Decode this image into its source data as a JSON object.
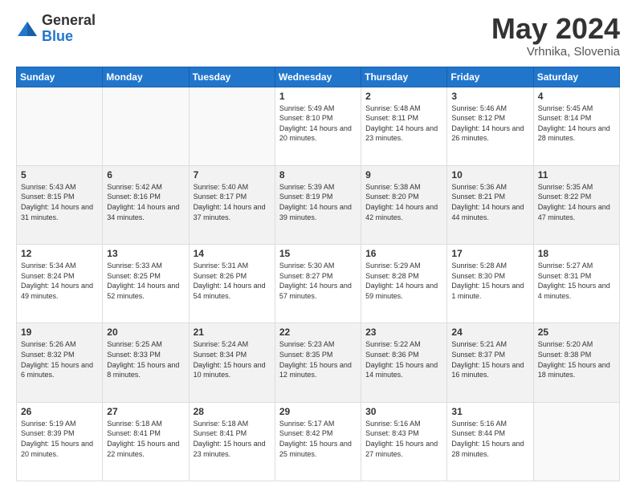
{
  "logo": {
    "general": "General",
    "blue": "Blue"
  },
  "title": "May 2024",
  "subtitle": "Vrhnika, Slovenia",
  "weekdays": [
    "Sunday",
    "Monday",
    "Tuesday",
    "Wednesday",
    "Thursday",
    "Friday",
    "Saturday"
  ],
  "weeks": [
    [
      {
        "day": "",
        "sunrise": "",
        "sunset": "",
        "daylight": ""
      },
      {
        "day": "",
        "sunrise": "",
        "sunset": "",
        "daylight": ""
      },
      {
        "day": "",
        "sunrise": "",
        "sunset": "",
        "daylight": ""
      },
      {
        "day": "1",
        "sunrise": "Sunrise: 5:49 AM",
        "sunset": "Sunset: 8:10 PM",
        "daylight": "Daylight: 14 hours and 20 minutes."
      },
      {
        "day": "2",
        "sunrise": "Sunrise: 5:48 AM",
        "sunset": "Sunset: 8:11 PM",
        "daylight": "Daylight: 14 hours and 23 minutes."
      },
      {
        "day": "3",
        "sunrise": "Sunrise: 5:46 AM",
        "sunset": "Sunset: 8:12 PM",
        "daylight": "Daylight: 14 hours and 26 minutes."
      },
      {
        "day": "4",
        "sunrise": "Sunrise: 5:45 AM",
        "sunset": "Sunset: 8:14 PM",
        "daylight": "Daylight: 14 hours and 28 minutes."
      }
    ],
    [
      {
        "day": "5",
        "sunrise": "Sunrise: 5:43 AM",
        "sunset": "Sunset: 8:15 PM",
        "daylight": "Daylight: 14 hours and 31 minutes."
      },
      {
        "day": "6",
        "sunrise": "Sunrise: 5:42 AM",
        "sunset": "Sunset: 8:16 PM",
        "daylight": "Daylight: 14 hours and 34 minutes."
      },
      {
        "day": "7",
        "sunrise": "Sunrise: 5:40 AM",
        "sunset": "Sunset: 8:17 PM",
        "daylight": "Daylight: 14 hours and 37 minutes."
      },
      {
        "day": "8",
        "sunrise": "Sunrise: 5:39 AM",
        "sunset": "Sunset: 8:19 PM",
        "daylight": "Daylight: 14 hours and 39 minutes."
      },
      {
        "day": "9",
        "sunrise": "Sunrise: 5:38 AM",
        "sunset": "Sunset: 8:20 PM",
        "daylight": "Daylight: 14 hours and 42 minutes."
      },
      {
        "day": "10",
        "sunrise": "Sunrise: 5:36 AM",
        "sunset": "Sunset: 8:21 PM",
        "daylight": "Daylight: 14 hours and 44 minutes."
      },
      {
        "day": "11",
        "sunrise": "Sunrise: 5:35 AM",
        "sunset": "Sunset: 8:22 PM",
        "daylight": "Daylight: 14 hours and 47 minutes."
      }
    ],
    [
      {
        "day": "12",
        "sunrise": "Sunrise: 5:34 AM",
        "sunset": "Sunset: 8:24 PM",
        "daylight": "Daylight: 14 hours and 49 minutes."
      },
      {
        "day": "13",
        "sunrise": "Sunrise: 5:33 AM",
        "sunset": "Sunset: 8:25 PM",
        "daylight": "Daylight: 14 hours and 52 minutes."
      },
      {
        "day": "14",
        "sunrise": "Sunrise: 5:31 AM",
        "sunset": "Sunset: 8:26 PM",
        "daylight": "Daylight: 14 hours and 54 minutes."
      },
      {
        "day": "15",
        "sunrise": "Sunrise: 5:30 AM",
        "sunset": "Sunset: 8:27 PM",
        "daylight": "Daylight: 14 hours and 57 minutes."
      },
      {
        "day": "16",
        "sunrise": "Sunrise: 5:29 AM",
        "sunset": "Sunset: 8:28 PM",
        "daylight": "Daylight: 14 hours and 59 minutes."
      },
      {
        "day": "17",
        "sunrise": "Sunrise: 5:28 AM",
        "sunset": "Sunset: 8:30 PM",
        "daylight": "Daylight: 15 hours and 1 minute."
      },
      {
        "day": "18",
        "sunrise": "Sunrise: 5:27 AM",
        "sunset": "Sunset: 8:31 PM",
        "daylight": "Daylight: 15 hours and 4 minutes."
      }
    ],
    [
      {
        "day": "19",
        "sunrise": "Sunrise: 5:26 AM",
        "sunset": "Sunset: 8:32 PM",
        "daylight": "Daylight: 15 hours and 6 minutes."
      },
      {
        "day": "20",
        "sunrise": "Sunrise: 5:25 AM",
        "sunset": "Sunset: 8:33 PM",
        "daylight": "Daylight: 15 hours and 8 minutes."
      },
      {
        "day": "21",
        "sunrise": "Sunrise: 5:24 AM",
        "sunset": "Sunset: 8:34 PM",
        "daylight": "Daylight: 15 hours and 10 minutes."
      },
      {
        "day": "22",
        "sunrise": "Sunrise: 5:23 AM",
        "sunset": "Sunset: 8:35 PM",
        "daylight": "Daylight: 15 hours and 12 minutes."
      },
      {
        "day": "23",
        "sunrise": "Sunrise: 5:22 AM",
        "sunset": "Sunset: 8:36 PM",
        "daylight": "Daylight: 15 hours and 14 minutes."
      },
      {
        "day": "24",
        "sunrise": "Sunrise: 5:21 AM",
        "sunset": "Sunset: 8:37 PM",
        "daylight": "Daylight: 15 hours and 16 minutes."
      },
      {
        "day": "25",
        "sunrise": "Sunrise: 5:20 AM",
        "sunset": "Sunset: 8:38 PM",
        "daylight": "Daylight: 15 hours and 18 minutes."
      }
    ],
    [
      {
        "day": "26",
        "sunrise": "Sunrise: 5:19 AM",
        "sunset": "Sunset: 8:39 PM",
        "daylight": "Daylight: 15 hours and 20 minutes."
      },
      {
        "day": "27",
        "sunrise": "Sunrise: 5:18 AM",
        "sunset": "Sunset: 8:41 PM",
        "daylight": "Daylight: 15 hours and 22 minutes."
      },
      {
        "day": "28",
        "sunrise": "Sunrise: 5:18 AM",
        "sunset": "Sunset: 8:41 PM",
        "daylight": "Daylight: 15 hours and 23 minutes."
      },
      {
        "day": "29",
        "sunrise": "Sunrise: 5:17 AM",
        "sunset": "Sunset: 8:42 PM",
        "daylight": "Daylight: 15 hours and 25 minutes."
      },
      {
        "day": "30",
        "sunrise": "Sunrise: 5:16 AM",
        "sunset": "Sunset: 8:43 PM",
        "daylight": "Daylight: 15 hours and 27 minutes."
      },
      {
        "day": "31",
        "sunrise": "Sunrise: 5:16 AM",
        "sunset": "Sunset: 8:44 PM",
        "daylight": "Daylight: 15 hours and 28 minutes."
      },
      {
        "day": "",
        "sunrise": "",
        "sunset": "",
        "daylight": ""
      }
    ]
  ]
}
